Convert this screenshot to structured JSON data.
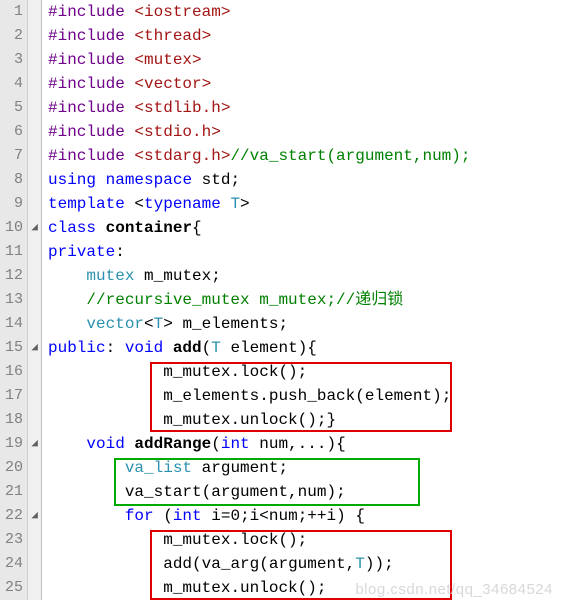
{
  "gutter": [
    "1",
    "2",
    "3",
    "4",
    "5",
    "6",
    "7",
    "8",
    "9",
    "10",
    "11",
    "12",
    "13",
    "14",
    "15",
    "16",
    "17",
    "18",
    "19",
    "20",
    "21",
    "22",
    "23",
    "24",
    "25"
  ],
  "fold": {
    "10": "◢",
    "15": "◢",
    "19": "◢",
    "22": "◢"
  },
  "tokens": {
    "pp": "#include",
    "inc1": "<iostream>",
    "inc2": "<thread>",
    "inc3": "<mutex>",
    "inc4": "<vector>",
    "inc5": "<stdlib.h>",
    "inc6": "<stdio.h>",
    "inc7": "<stdarg.h>",
    "cmt7": "//va_start(argument,num);",
    "using": "using",
    "ns": "namespace",
    "std": "std",
    "template": "template",
    "typename": "typename",
    "T": "T",
    "class": "class",
    "container": "container",
    "private": "private",
    "public": "public",
    "mutex": "mutex",
    "m_mutex": "m_mutex",
    "cmt13": "//recursive_mutex m_mutex;//递归锁",
    "vector": "vector",
    "m_elements": "m_elements",
    "void": "void",
    "add": "add",
    "element": "element",
    "lock": "lock",
    "push_back": "push_back",
    "unlock": "unlock",
    "addRange": "addRange",
    "int": "int",
    "num": "num",
    "va_list": "va_list",
    "argument": "argument",
    "va_start": "va_start",
    "for": "for",
    "i": "i",
    "va_arg": "va_arg"
  },
  "watermark": "blog.csdn.net/qq_34684524",
  "chart_data": {
    "type": "table",
    "title": "C++ mutex container code snippet",
    "lines": [
      {
        "n": 1,
        "text": "#include <iostream>"
      },
      {
        "n": 2,
        "text": "#include <thread>"
      },
      {
        "n": 3,
        "text": "#include <mutex>"
      },
      {
        "n": 4,
        "text": "#include <vector>"
      },
      {
        "n": 5,
        "text": "#include <stdlib.h>"
      },
      {
        "n": 6,
        "text": "#include <stdio.h>"
      },
      {
        "n": 7,
        "text": "#include <stdarg.h>//va_start(argument,num);"
      },
      {
        "n": 8,
        "text": "using namespace std;"
      },
      {
        "n": 9,
        "text": "template <typename T>"
      },
      {
        "n": 10,
        "text": "class container{"
      },
      {
        "n": 11,
        "text": "private:"
      },
      {
        "n": 12,
        "text": "    mutex m_mutex;"
      },
      {
        "n": 13,
        "text": "    //recursive_mutex m_mutex;//递归锁"
      },
      {
        "n": 14,
        "text": "    vector<T> m_elements;"
      },
      {
        "n": 15,
        "text": "public: void add(T element){"
      },
      {
        "n": 16,
        "text": "            m_mutex.lock();"
      },
      {
        "n": 17,
        "text": "            m_elements.push_back(element);"
      },
      {
        "n": 18,
        "text": "            m_mutex.unlock();}"
      },
      {
        "n": 19,
        "text": "    void addRange(int num,...){"
      },
      {
        "n": 20,
        "text": "        va_list argument;"
      },
      {
        "n": 21,
        "text": "        va_start(argument,num);"
      },
      {
        "n": 22,
        "text": "        for (int i=0;i<num;++i) {"
      },
      {
        "n": 23,
        "text": "            m_mutex.lock();"
      },
      {
        "n": 24,
        "text": "            add(va_arg(argument,T));"
      },
      {
        "n": 25,
        "text": "            m_mutex.unlock();"
      }
    ],
    "highlights": [
      {
        "color": "red",
        "lines": [
          16,
          17,
          18
        ]
      },
      {
        "color": "green",
        "lines": [
          20,
          21
        ]
      },
      {
        "color": "red",
        "lines": [
          23,
          24,
          25
        ]
      }
    ]
  }
}
